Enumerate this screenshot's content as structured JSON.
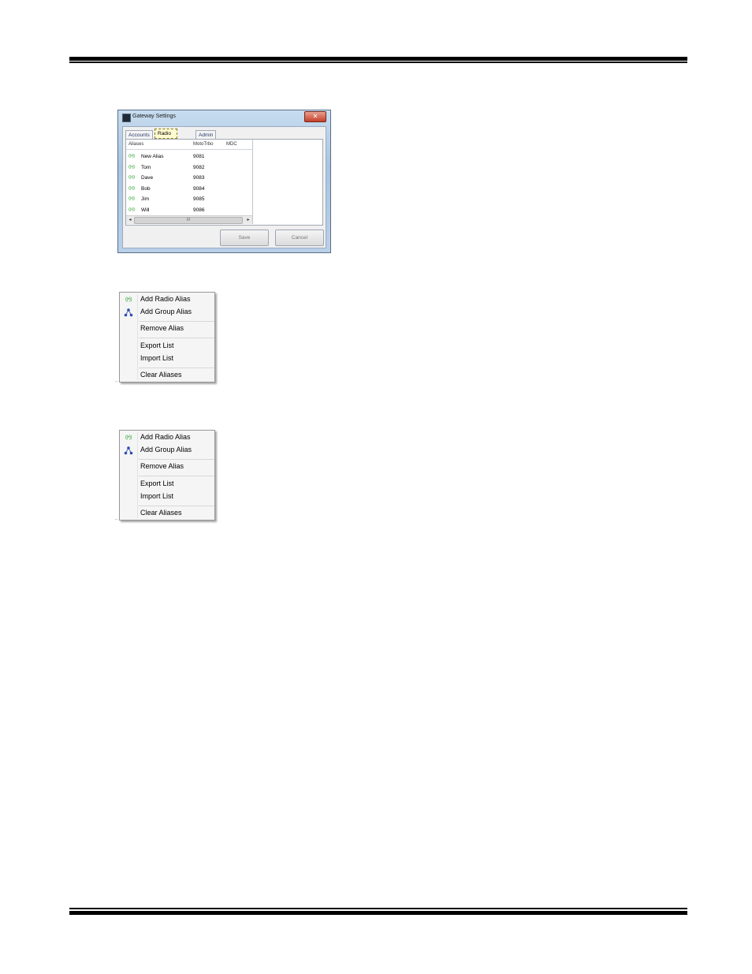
{
  "window": {
    "title": "Gateway Settings",
    "close_glyph": "✕",
    "tabs": [
      "Accounts",
      "Radio Aliases",
      "Admin"
    ],
    "columns": [
      "Aliases",
      "MotoTrbo",
      "MDC"
    ],
    "rows": [
      {
        "icon": "radio-icon",
        "name": "New Alias",
        "mototrbo": "9081"
      },
      {
        "icon": "radio-icon",
        "name": "Tom",
        "mototrbo": "9082"
      },
      {
        "icon": "radio-icon",
        "name": "Dave",
        "mototrbo": "9083"
      },
      {
        "icon": "radio-icon",
        "name": "Bob",
        "mototrbo": "9084"
      },
      {
        "icon": "radio-icon",
        "name": "Jim",
        "mototrbo": "9085"
      },
      {
        "icon": "radio-icon",
        "name": "Will",
        "mototrbo": "9086"
      }
    ],
    "scroll_thumb": "III",
    "scroll_left": "◂",
    "scroll_right": "▸",
    "save_label": "Save",
    "cancel_label": "Cancel",
    "radio_glyph": "((•))"
  },
  "menu": {
    "add_radio_alias": "Add Radio Alias",
    "add_group_alias": "Add Group Alias",
    "remove_alias": "Remove Alias",
    "export_list": "Export List",
    "import_list": "Import List",
    "clear_aliases": "Clear Aliases",
    "radio_glyph": "((•))",
    "tick": ".."
  },
  "colors": {
    "radio_icon": "#2aa02a",
    "group_icon": "#2c4fb0",
    "active_tab": "#fffbcf"
  }
}
